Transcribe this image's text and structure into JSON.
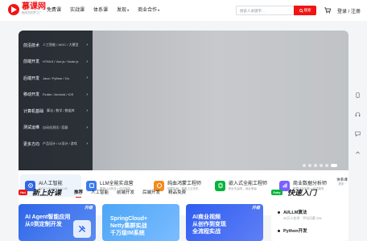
{
  "brand": {
    "name": "慕课网",
    "slogan": "程序员的梦工厂",
    "color": "#f01414"
  },
  "nav": [
    {
      "label": "免费课",
      "has_caret": false
    },
    {
      "label": "实战课",
      "has_caret": false
    },
    {
      "label": "体系课",
      "has_caret": false
    },
    {
      "label": "发现",
      "has_caret": true
    },
    {
      "label": "商业合作",
      "has_caret": true
    }
  ],
  "search": {
    "placeholder": "搜索人关键字...",
    "button_label": "搜索"
  },
  "auth_label": "登录 / 注册",
  "categories": [
    {
      "title": "前沿技术",
      "sub": "人工智能 / AIGC / 大模型"
    },
    {
      "title": "前端开发",
      "sub": "HTML5 / Vue.js / Node.js"
    },
    {
      "title": "后端开发",
      "sub": "Java / Python / Go"
    },
    {
      "title": "移动开发",
      "sub": "Flutter / Android / iOS"
    },
    {
      "title": "计算机基础",
      "sub": "算法 / 数学 / 数据库"
    },
    {
      "title": "测试运维",
      "sub": "自动化测试 / 容器"
    },
    {
      "title": "更多方向",
      "sub": "产品设计 / UI设计 / 游戏"
    }
  ],
  "carousel": {
    "count": 6,
    "active": 5
  },
  "paths": [
    {
      "title": "AI人工智能",
      "desc": "AIGC | ChatGPT | LLM",
      "icon": "ai-icon",
      "color": "#2f66e8"
    },
    {
      "title": "LLM全能实战营",
      "desc": "覆盖LLM的全一站式服务",
      "icon": "llm-icon",
      "color": "#3a7bf0"
    },
    {
      "title": "纯血鸿蒙工程师",
      "desc": "前瞻布局，赛跑上云先机",
      "icon": "harmony-icon",
      "color": "#f58b1f"
    },
    {
      "title": "嵌入式全能工程师",
      "desc": "职业先赢机，就业率高",
      "icon": "embedded-icon",
      "color": "#00b43c"
    },
    {
      "title": "商业数据分析师",
      "desc": "数据分析到数一站式服务",
      "icon": "data-icon",
      "color": "#7b61ff"
    }
  ],
  "paths_more": {
    "title": "体系课",
    "count": "更多 ›"
  },
  "section_new": {
    "badge": "Hot",
    "title": "新上好课",
    "tabs": [
      "推荐",
      "人工智能",
      "前端开发",
      "后端开发",
      "精品免费"
    ],
    "active_tab": 0
  },
  "courses": [
    {
      "title": "AI Agent智能应用\n从0到定制开发",
      "tag": "升级"
    },
    {
      "title": "SpringCloud+\nNetty集群实战\n千万级IM系统",
      "tag": ""
    },
    {
      "title": "AI商业视频\n从创作到变现\n全流程实战",
      "tag": "升级"
    }
  ],
  "section_intro": {
    "badge": "Entry",
    "title": "快速入门"
  },
  "guides": [
    {
      "title": "AI/LLM算法",
      "meta": "30万人在学 · 平均月薪 25k"
    },
    {
      "title": "Python开发",
      "meta": ""
    }
  ]
}
